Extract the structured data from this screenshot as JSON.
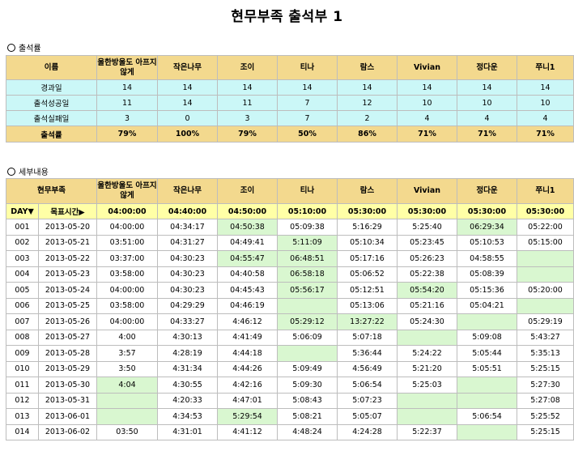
{
  "title": "현무부족 출석부 1",
  "summary": {
    "section_label": "출석률",
    "name_header": "이름",
    "columns": [
      "울한방울도 아프지 않게",
      "작은나무",
      "조이",
      "티나",
      "람스",
      "Vivian",
      "정다운",
      "쭈니1"
    ],
    "rows": [
      {
        "label": "경과일",
        "values": [
          "14",
          "14",
          "14",
          "14",
          "14",
          "14",
          "14",
          "14"
        ]
      },
      {
        "label": "출석성공일",
        "values": [
          "11",
          "14",
          "11",
          "7",
          "12",
          "10",
          "10",
          "10"
        ]
      },
      {
        "label": "출석실패일",
        "values": [
          "3",
          "0",
          "3",
          "7",
          "2",
          "4",
          "4",
          "4"
        ]
      }
    ],
    "rate_label": "출석률",
    "rates": [
      "79%",
      "100%",
      "79%",
      "50%",
      "86%",
      "71%",
      "71%",
      "71%"
    ]
  },
  "detail": {
    "section_label": "세부내용",
    "tribe_header": "현무부족",
    "day_label": "DAY▼",
    "target_label": "목표시간▶",
    "target_times": [
      "04:00:00",
      "04:40:00",
      "04:50:00",
      "05:10:00",
      "05:30:00",
      "05:30:00",
      "05:30:00",
      "05:30:00"
    ],
    "rows": [
      {
        "day": "001",
        "date": "2013-05-20",
        "cells": [
          {
            "v": "04:00:00",
            "g": false
          },
          {
            "v": "04:34:17",
            "g": false
          },
          {
            "v": "04:50:38",
            "g": true
          },
          {
            "v": "05:09:38",
            "g": false
          },
          {
            "v": "5:16:29",
            "g": false
          },
          {
            "v": "5:25:40",
            "g": false
          },
          {
            "v": "06:29:34",
            "g": true
          },
          {
            "v": "05:22:00",
            "g": false
          }
        ]
      },
      {
        "day": "002",
        "date": "2013-05-21",
        "cells": [
          {
            "v": "03:51:00",
            "g": false
          },
          {
            "v": "04:31:27",
            "g": false
          },
          {
            "v": "04:49:41",
            "g": false
          },
          {
            "v": "5:11:09",
            "g": true
          },
          {
            "v": "05:10:34",
            "g": false
          },
          {
            "v": "05:23:45",
            "g": false
          },
          {
            "v": "05:10:53",
            "g": false
          },
          {
            "v": "05:15:00",
            "g": false
          }
        ]
      },
      {
        "day": "003",
        "date": "2013-05-22",
        "cells": [
          {
            "v": "03:37:00",
            "g": false
          },
          {
            "v": "04:30:23",
            "g": false
          },
          {
            "v": "04:55:47",
            "g": true
          },
          {
            "v": "06:48:51",
            "g": true
          },
          {
            "v": "05:17:16",
            "g": false
          },
          {
            "v": "05:26:23",
            "g": false
          },
          {
            "v": "04:58:55",
            "g": false
          },
          {
            "v": "",
            "g": true
          }
        ]
      },
      {
        "day": "004",
        "date": "2013-05-23",
        "cells": [
          {
            "v": "03:58:00",
            "g": false
          },
          {
            "v": "04:30:23",
            "g": false
          },
          {
            "v": "04:40:58",
            "g": false
          },
          {
            "v": "06:58:18",
            "g": true
          },
          {
            "v": "05:06:52",
            "g": false
          },
          {
            "v": "05:22:38",
            "g": false
          },
          {
            "v": "05:08:39",
            "g": false
          },
          {
            "v": "",
            "g": true
          }
        ]
      },
      {
        "day": "005",
        "date": "2013-05-24",
        "cells": [
          {
            "v": "04:00:00",
            "g": false
          },
          {
            "v": "04:30:23",
            "g": false
          },
          {
            "v": "04:45:43",
            "g": false
          },
          {
            "v": "05:56:17",
            "g": true
          },
          {
            "v": "05:12:51",
            "g": false
          },
          {
            "v": "05:54:20",
            "g": true
          },
          {
            "v": "05:15:36",
            "g": false
          },
          {
            "v": "05:20:00",
            "g": false
          }
        ]
      },
      {
        "day": "006",
        "date": "2013-05-25",
        "cells": [
          {
            "v": "03:58:00",
            "g": false
          },
          {
            "v": "04:29:29",
            "g": false
          },
          {
            "v": "04:46:19",
            "g": false
          },
          {
            "v": "",
            "g": true
          },
          {
            "v": "05:13:06",
            "g": false
          },
          {
            "v": "05:21:16",
            "g": false
          },
          {
            "v": "05:04:21",
            "g": false
          },
          {
            "v": "",
            "g": true
          }
        ]
      },
      {
        "day": "007",
        "date": "2013-05-26",
        "cells": [
          {
            "v": "04:00:00",
            "g": false
          },
          {
            "v": "04:33:27",
            "g": false
          },
          {
            "v": "4:46:12",
            "g": false
          },
          {
            "v": "05:29:12",
            "g": true
          },
          {
            "v": "13:27:22",
            "g": true
          },
          {
            "v": "05:24:30",
            "g": false
          },
          {
            "v": "",
            "g": true
          },
          {
            "v": "05:29:19",
            "g": false
          }
        ]
      },
      {
        "day": "008",
        "date": "2013-05-27",
        "cells": [
          {
            "v": "4:00",
            "g": false
          },
          {
            "v": "4:30:13",
            "g": false
          },
          {
            "v": "4:41:49",
            "g": false
          },
          {
            "v": "5:06:09",
            "g": false
          },
          {
            "v": "5:07:18",
            "g": false
          },
          {
            "v": "",
            "g": true
          },
          {
            "v": "5:09:08",
            "g": false
          },
          {
            "v": "5:43:27",
            "g": false
          }
        ]
      },
      {
        "day": "009",
        "date": "2013-05-28",
        "cells": [
          {
            "v": "3:57",
            "g": false
          },
          {
            "v": "4:28:19",
            "g": false
          },
          {
            "v": "4:44:18",
            "g": false
          },
          {
            "v": "",
            "g": true
          },
          {
            "v": "5:36:44",
            "g": false
          },
          {
            "v": "5:24:22",
            "g": false
          },
          {
            "v": "5:05:44",
            "g": false
          },
          {
            "v": "5:35:13",
            "g": false
          }
        ]
      },
      {
        "day": "010",
        "date": "2013-05-29",
        "cells": [
          {
            "v": "3:50",
            "g": false
          },
          {
            "v": "4:31:34",
            "g": false
          },
          {
            "v": "4:44:26",
            "g": false
          },
          {
            "v": "5:09:49",
            "g": false
          },
          {
            "v": "4:56:49",
            "g": false
          },
          {
            "v": "5:21:20",
            "g": false
          },
          {
            "v": "5:05:51",
            "g": false
          },
          {
            "v": "5:25:15",
            "g": false
          }
        ]
      },
      {
        "day": "011",
        "date": "2013-05-30",
        "cells": [
          {
            "v": "4:04",
            "g": true
          },
          {
            "v": "4:30:55",
            "g": false
          },
          {
            "v": "4:42:16",
            "g": false
          },
          {
            "v": "5:09:30",
            "g": false
          },
          {
            "v": "5:06:54",
            "g": false
          },
          {
            "v": "5:25:03",
            "g": false
          },
          {
            "v": "",
            "g": true
          },
          {
            "v": "5:27:30",
            "g": false
          }
        ]
      },
      {
        "day": "012",
        "date": "2013-05-31",
        "cells": [
          {
            "v": "",
            "g": true
          },
          {
            "v": "4:20:33",
            "g": false
          },
          {
            "v": "4:47:01",
            "g": false
          },
          {
            "v": "5:08:43",
            "g": false
          },
          {
            "v": "5:07:23",
            "g": false
          },
          {
            "v": "",
            "g": true
          },
          {
            "v": "",
            "g": true
          },
          {
            "v": "5:27:08",
            "g": false
          }
        ]
      },
      {
        "day": "013",
        "date": "2013-06-01",
        "cells": [
          {
            "v": "",
            "g": true
          },
          {
            "v": "4:34:53",
            "g": false
          },
          {
            "v": "5:29:54",
            "g": true
          },
          {
            "v": "5:08:21",
            "g": false
          },
          {
            "v": "5:05:07",
            "g": false
          },
          {
            "v": "",
            "g": true
          },
          {
            "v": "5:06:54",
            "g": false
          },
          {
            "v": "5:25:52",
            "g": false
          }
        ]
      },
      {
        "day": "014",
        "date": "2013-06-02",
        "cells": [
          {
            "v": "03:50",
            "g": false
          },
          {
            "v": "4:31:01",
            "g": false
          },
          {
            "v": "4:41:12",
            "g": false
          },
          {
            "v": "4:48:24",
            "g": false
          },
          {
            "v": "4:24:28",
            "g": false
          },
          {
            "v": "5:22:37",
            "g": false
          },
          {
            "v": "",
            "g": true
          },
          {
            "v": "5:25:15",
            "g": false
          }
        ]
      }
    ]
  }
}
